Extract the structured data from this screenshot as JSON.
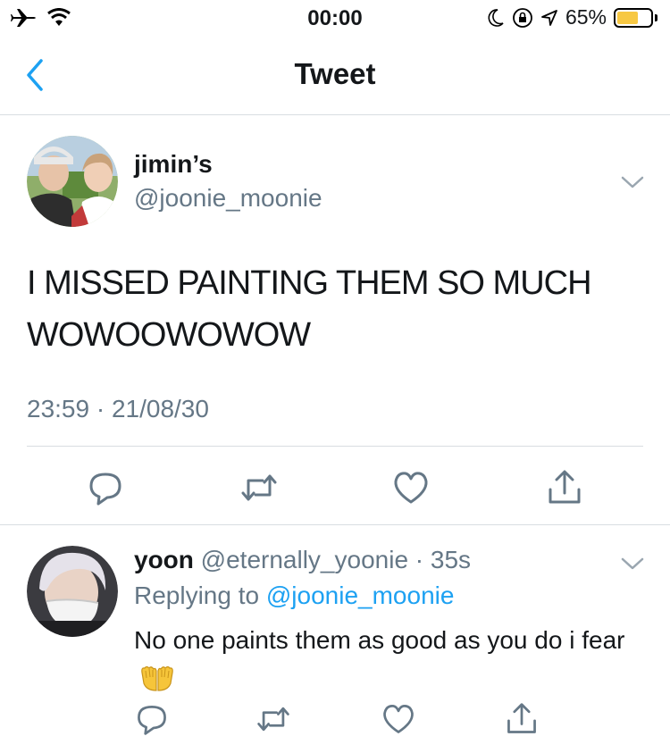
{
  "status_bar": {
    "time": "00:00",
    "battery_percent": "65%",
    "battery_level": 0.65,
    "icons": [
      "airplane-icon",
      "wifi-icon",
      "moon-icon",
      "rotation-lock-icon",
      "location-icon",
      "battery-icon"
    ]
  },
  "nav": {
    "title": "Tweet",
    "back_icon": "chevron-left-icon"
  },
  "main_tweet": {
    "display_name": "jimin’s",
    "handle": "@joonie_moonie",
    "text": "I MISSED PAINTING THEM SO MUCH WOWOOWOWOW",
    "timestamp": "23:59 · 21/08/30",
    "actions": [
      "reply-icon",
      "retweet-icon",
      "like-icon",
      "share-icon"
    ]
  },
  "reply": {
    "display_name": "yoon",
    "handle": "@eternally_yoonie",
    "separator": " · ",
    "age": "35s",
    "replying_prefix": "Replying to ",
    "replying_to": "@joonie_moonie",
    "text": "No one paints them as good as you do i fear",
    "emoji": "palms-up-together-emoji",
    "actions": [
      "reply-icon",
      "retweet-icon",
      "like-icon",
      "share-icon"
    ]
  },
  "colors": {
    "accent": "#1da1f2",
    "muted": "#657786",
    "divider": "#d8dde1",
    "battery": "#f7c843"
  }
}
